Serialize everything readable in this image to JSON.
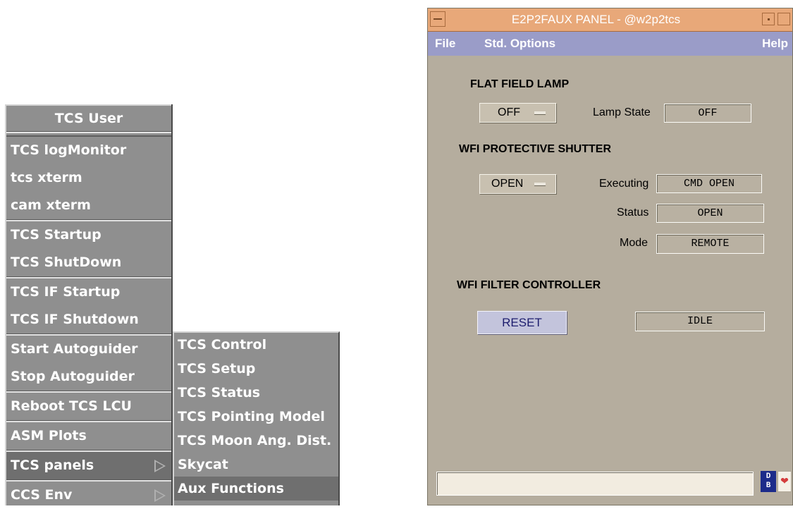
{
  "tcs_user_menu": {
    "title": "TCS User",
    "items": [
      "TCS logMonitor",
      "tcs xterm",
      "cam  xterm",
      "TCS Startup",
      "TCS ShutDown",
      "TCS IF Startup",
      "TCS IF Shutdown",
      "Start Autoguider",
      "Stop Autoguider",
      "Reboot TCS LCU",
      "ASM Plots",
      "TCS panels",
      "CCS Env"
    ],
    "active_item": "TCS panels"
  },
  "tcs_panels_submenu": {
    "items": [
      "TCS Control",
      "TCS Setup",
      "TCS Status",
      "TCS Pointing Model",
      "TCS Moon Ang. Dist.",
      "Skycat",
      "Aux Functions"
    ],
    "active_item": "Aux Functions"
  },
  "panel": {
    "window_title": "E2P2FAUX PANEL - @w2p2tcs",
    "menubar": {
      "file": "File",
      "std_options": "Std. Options",
      "help": "Help"
    },
    "flat_field": {
      "header": "FLAT FIELD LAMP",
      "option": "OFF",
      "lamp_state_label": "Lamp State",
      "lamp_state_value": "OFF"
    },
    "shutter": {
      "header": "WFI  PROTECTIVE SHUTTER",
      "option": "OPEN",
      "executing_label": "Executing",
      "executing_value": "CMD OPEN",
      "status_label": "Status",
      "status_value": "OPEN",
      "mode_label": "Mode",
      "mode_value": "REMOTE"
    },
    "filter": {
      "header": "WFI FILTER CONTROLLER",
      "reset_label": "RESET",
      "state_value": "IDLE"
    },
    "footer": {
      "db_icon_text": "D\nB"
    }
  },
  "colors": {
    "menu_bg": "#8f8f8f",
    "title_bar": "#e8a879",
    "menubar": "#9a9cc8",
    "panel_bg": "#b5ad9e"
  }
}
